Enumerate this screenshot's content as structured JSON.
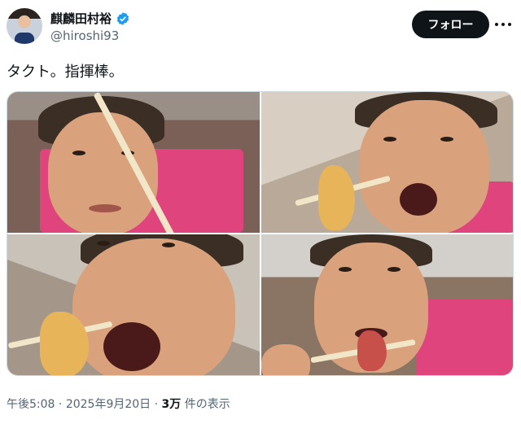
{
  "user": {
    "display_name": "麒麟田村裕",
    "handle": "@hiroshi93"
  },
  "header": {
    "follow_label": "フォロー"
  },
  "tweet": {
    "text": "タクト。指揮棒。"
  },
  "meta": {
    "time": "午後5:08",
    "date": "2025年9月20日",
    "views_count": "3万",
    "views_label": "件の表示"
  },
  "colors": {
    "follow_bg": "#0f1419",
    "verified": "#1d9bf0",
    "secondary_text": "#536471"
  }
}
